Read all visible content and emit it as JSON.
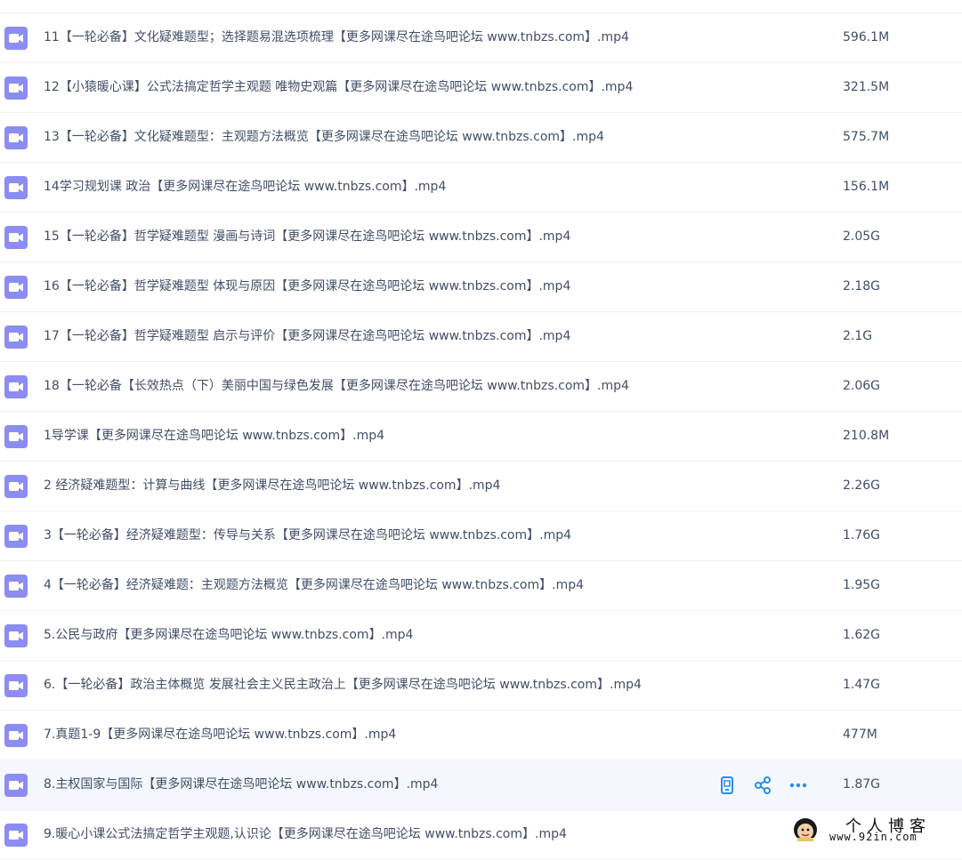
{
  "colors": {
    "video_icon": "#8c8cf3",
    "action_icon": "#2a8ee9",
    "row_hover": "#f4f8fe",
    "text": "#424e67"
  },
  "files": [
    {
      "name": "",
      "size": ""
    },
    {
      "name": "11【一轮必备】文化疑难题型；选择题易混选项梳理【更多网课尽在途鸟吧论坛 www.tnbzs.com】.mp4",
      "size": "596.1M"
    },
    {
      "name": "12【小猿暖心课】公式法搞定哲学主观题 唯物史观篇【更多网课尽在途鸟吧论坛 www.tnbzs.com】.mp4",
      "size": "321.5M"
    },
    {
      "name": "13【一轮必备】文化疑难题型：主观题方法概览【更多网课尽在途鸟吧论坛 www.tnbzs.com】.mp4",
      "size": "575.7M"
    },
    {
      "name": "14学习规划课 政治【更多网课尽在途鸟吧论坛 www.tnbzs.com】.mp4",
      "size": "156.1M"
    },
    {
      "name": "15【一轮必备】哲学疑难题型 漫画与诗词【更多网课尽在途鸟吧论坛 www.tnbzs.com】.mp4",
      "size": "2.05G"
    },
    {
      "name": "16【一轮必备】哲学疑难题型 体现与原因【更多网课尽在途鸟吧论坛 www.tnbzs.com】.mp4",
      "size": "2.18G"
    },
    {
      "name": "17【一轮必备】哲学疑难题型 启示与评价【更多网课尽在途鸟吧论坛 www.tnbzs.com】.mp4",
      "size": "2.1G"
    },
    {
      "name": "18【一轮必备【长效热点（下）美丽中国与绿色发展【更多网课尽在途鸟吧论坛 www.tnbzs.com】.mp4",
      "size": "2.06G"
    },
    {
      "name": "1导学课【更多网课尽在途鸟吧论坛 www.tnbzs.com】.mp4",
      "size": "210.8M"
    },
    {
      "name": "2 经济疑难题型：计算与曲线【更多网课尽在途鸟吧论坛 www.tnbzs.com】.mp4",
      "size": "2.26G"
    },
    {
      "name": "3【一轮必备】经济疑难题型：传导与关系【更多网课尽在途鸟吧论坛 www.tnbzs.com】.mp4",
      "size": "1.76G"
    },
    {
      "name": "4【一轮必备】经济疑难题：主观题方法概览【更多网课尽在途鸟吧论坛 www.tnbzs.com】.mp4",
      "size": "1.95G"
    },
    {
      "name": "5.公民与政府【更多网课尽在途鸟吧论坛 www.tnbzs.com】.mp4",
      "size": "1.62G"
    },
    {
      "name": "6.【一轮必备】政治主体概览 发展社会主义民主政治上【更多网课尽在途鸟吧论坛 www.tnbzs.com】.mp4",
      "size": "1.47G"
    },
    {
      "name": "7.真题1-9【更多网课尽在途鸟吧论坛 www.tnbzs.com】.mp4",
      "size": "477M"
    },
    {
      "name": "8.主权国家与国际【更多网课尽在途鸟吧论坛 www.tnbzs.com】.mp4",
      "size": "1.87G",
      "hover": true
    },
    {
      "name": "9.暖心小课公式法搞定哲学主观题,认识论【更多网课尽在途鸟吧论坛 www.tnbzs.com】.mp4",
      "size": ""
    }
  ],
  "row_actions": [
    {
      "icon": "mobile-icon"
    },
    {
      "icon": "share-icon"
    },
    {
      "icon": "more-icon"
    }
  ],
  "watermark": {
    "title": "个人博客",
    "url": "www.92in.com"
  }
}
